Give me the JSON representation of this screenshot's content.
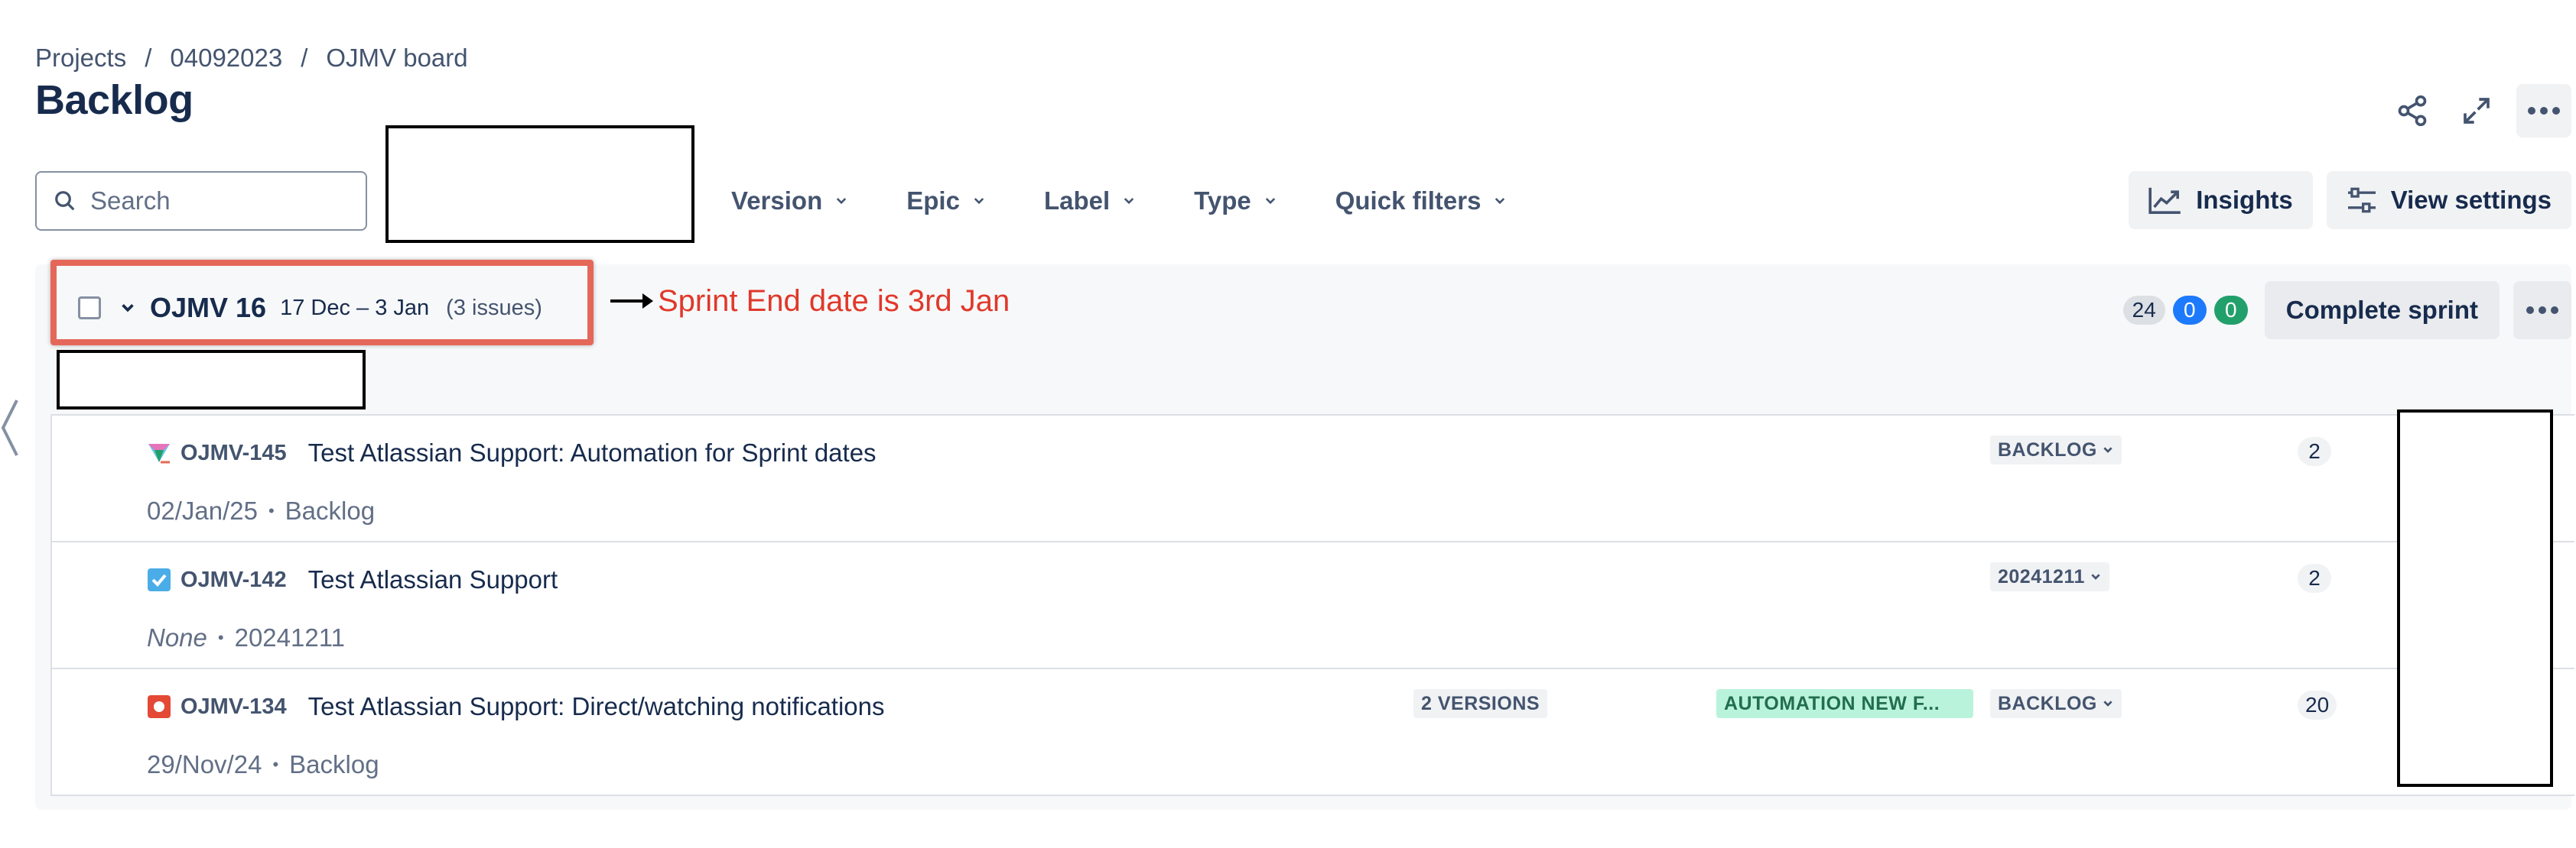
{
  "breadcrumb": {
    "items": [
      "Projects",
      "04092023",
      "OJMV board"
    ],
    "separator": "/"
  },
  "page": {
    "title": "Backlog"
  },
  "toolbar": {
    "search_placeholder": "Search",
    "filters": [
      "Version",
      "Epic",
      "Label",
      "Type",
      "Quick filters"
    ],
    "insights_label": "Insights",
    "view_settings_label": "View settings"
  },
  "sprint": {
    "name": "OJMV 16",
    "dates": "17 Dec – 3 Jan",
    "issue_count": "(3 issues)",
    "annotation": "Sprint End date is 3rd Jan",
    "counts": {
      "total": "24",
      "in_progress": "0",
      "done": "0"
    },
    "complete_label": "Complete sprint"
  },
  "issues": [
    {
      "key": "OJMV-145",
      "summary": "Test Atlassian Support: Automation for Sprint dates",
      "date": "02/Jan/25",
      "sub_status": "Backlog",
      "status": "BACKLOG",
      "points": "2",
      "type_icon": "epic-filter-icon"
    },
    {
      "key": "OJMV-142",
      "summary": "Test Atlassian Support",
      "date": "None",
      "sub_status": "20241211",
      "status": "20241211",
      "points": "2",
      "type_icon": "task-icon"
    },
    {
      "key": "OJMV-134",
      "summary": "Test Atlassian Support: Direct/watching notifications",
      "date": "29/Nov/24",
      "sub_status": "Backlog",
      "status": "BACKLOG",
      "versions": "2 VERSIONS",
      "epic": "AUTOMATION NEW F...",
      "points": "20",
      "type_icon": "bug-icon"
    }
  ],
  "colors": {
    "accent_blue": "#1d7afc",
    "done_green": "#22a06b",
    "annotation_red": "#e0382a",
    "highlight_box": "#e5675a",
    "epic_green_bg": "#baf3db"
  }
}
